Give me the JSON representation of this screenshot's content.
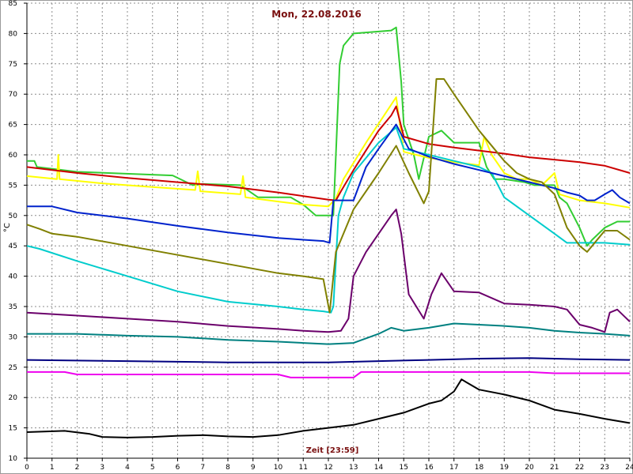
{
  "chart_data": {
    "type": "line",
    "title": "Mon, 22.08.2016",
    "xlabel": "Zeit [23:59]",
    "ylabel": "°C",
    "xlim": [
      0,
      24
    ],
    "ylim": [
      10,
      85
    ],
    "xticks": [
      0,
      1,
      2,
      3,
      4,
      5,
      6,
      7,
      8,
      9,
      10,
      11,
      12,
      13,
      14,
      15,
      16,
      17,
      18,
      19,
      20,
      21,
      22,
      23,
      24
    ],
    "yticks": [
      10,
      15,
      20,
      25,
      30,
      35,
      40,
      45,
      50,
      55,
      60,
      65,
      70,
      75,
      80,
      85
    ],
    "grid": true,
    "grid_style": "dashed",
    "legend": "none",
    "series": [
      {
        "color": "#32cd32",
        "points": [
          [
            0,
            59
          ],
          [
            0.3,
            59
          ],
          [
            0.4,
            58
          ],
          [
            2,
            57.2
          ],
          [
            5.8,
            56.6
          ],
          [
            6.6,
            55
          ],
          [
            7,
            55.2
          ],
          [
            8.5,
            55
          ],
          [
            9.2,
            53
          ],
          [
            10.5,
            53
          ],
          [
            11,
            51.8
          ],
          [
            11.5,
            50
          ],
          [
            12.2,
            50
          ],
          [
            12.3,
            60
          ],
          [
            12.45,
            75
          ],
          [
            12.6,
            78
          ],
          [
            13,
            80
          ],
          [
            14.5,
            80.5
          ],
          [
            14.7,
            81
          ],
          [
            14.9,
            72
          ],
          [
            15,
            65
          ],
          [
            15.4,
            60
          ],
          [
            15.6,
            56
          ],
          [
            16,
            63
          ],
          [
            16.5,
            64
          ],
          [
            17,
            62
          ],
          [
            18,
            62
          ],
          [
            18.3,
            58
          ],
          [
            18.6,
            56
          ],
          [
            19,
            56
          ],
          [
            19.8,
            55.5
          ],
          [
            20.2,
            55
          ],
          [
            21,
            55
          ],
          [
            21.2,
            53
          ],
          [
            21.5,
            52
          ],
          [
            22,
            48
          ],
          [
            22.3,
            45
          ],
          [
            22.5,
            46
          ],
          [
            23,
            48
          ],
          [
            23.5,
            49
          ],
          [
            24,
            49
          ]
        ]
      },
      {
        "color": "#ffff00",
        "points": [
          [
            0,
            56.5
          ],
          [
            1.2,
            56
          ],
          [
            1.25,
            60
          ],
          [
            1.3,
            56
          ],
          [
            3,
            55.3
          ],
          [
            5,
            54.7
          ],
          [
            6.7,
            54.2
          ],
          [
            6.8,
            57.3
          ],
          [
            6.9,
            54
          ],
          [
            8.5,
            53.5
          ],
          [
            8.6,
            56.5
          ],
          [
            8.7,
            53
          ],
          [
            10,
            52.3
          ],
          [
            11,
            51.8
          ],
          [
            12,
            51.5
          ],
          [
            12.3,
            52.8
          ],
          [
            12.6,
            56
          ],
          [
            13.5,
            62
          ],
          [
            14.3,
            67
          ],
          [
            14.7,
            69.5
          ],
          [
            15,
            60.5
          ],
          [
            15.5,
            60
          ],
          [
            16,
            59.5
          ],
          [
            17,
            58.8
          ],
          [
            18,
            58.3
          ],
          [
            18.2,
            63
          ],
          [
            18.5,
            60
          ],
          [
            19,
            57
          ],
          [
            19.5,
            56
          ],
          [
            20,
            56
          ],
          [
            20.5,
            55
          ],
          [
            21,
            57
          ],
          [
            21.2,
            53.5
          ],
          [
            22,
            52.5
          ],
          [
            23,
            52
          ],
          [
            24,
            51.3
          ]
        ]
      },
      {
        "color": "#cc0000",
        "points": [
          [
            0,
            58
          ],
          [
            2,
            57
          ],
          [
            4,
            56.2
          ],
          [
            6,
            55.5
          ],
          [
            8,
            54.8
          ],
          [
            10,
            53.8
          ],
          [
            11,
            53.2
          ],
          [
            12,
            52.6
          ],
          [
            12.3,
            52.5
          ],
          [
            12.5,
            54
          ],
          [
            13,
            57.5
          ],
          [
            14,
            64
          ],
          [
            14.5,
            66.5
          ],
          [
            14.7,
            68
          ],
          [
            15,
            63
          ],
          [
            16,
            61.8
          ],
          [
            17,
            61.2
          ],
          [
            18,
            60.7
          ],
          [
            19,
            60.2
          ],
          [
            20,
            59.6
          ],
          [
            21,
            59.2
          ],
          [
            22,
            58.8
          ],
          [
            23,
            58.2
          ],
          [
            24,
            57
          ]
        ]
      },
      {
        "color": "#00cccc",
        "points": [
          [
            0,
            45
          ],
          [
            0.5,
            44.5
          ],
          [
            2,
            42.5
          ],
          [
            4,
            40
          ],
          [
            6,
            37.5
          ],
          [
            8,
            35.8
          ],
          [
            10,
            35
          ],
          [
            11,
            34.5
          ],
          [
            11.8,
            34.2
          ],
          [
            12.1,
            34
          ],
          [
            12.2,
            35
          ],
          [
            12.4,
            50
          ],
          [
            12.6,
            53
          ],
          [
            13,
            57
          ],
          [
            14,
            62
          ],
          [
            14.7,
            64.5
          ],
          [
            15,
            61
          ],
          [
            16,
            60
          ],
          [
            16.5,
            59.5
          ],
          [
            17,
            59
          ],
          [
            17.5,
            58.5
          ],
          [
            18,
            58
          ],
          [
            18.5,
            57
          ],
          [
            19,
            53
          ],
          [
            20,
            50
          ],
          [
            21,
            47
          ],
          [
            21.5,
            45.5
          ],
          [
            22,
            45.5
          ],
          [
            23,
            45.5
          ],
          [
            24,
            45.2
          ]
        ]
      },
      {
        "color": "#0022cc",
        "points": [
          [
            0,
            51.5
          ],
          [
            1,
            51.5
          ],
          [
            2,
            50.5
          ],
          [
            4,
            49.5
          ],
          [
            6,
            48.3
          ],
          [
            8,
            47.2
          ],
          [
            10,
            46.3
          ],
          [
            11,
            46
          ],
          [
            11.8,
            45.8
          ],
          [
            12.05,
            45.5
          ],
          [
            12.2,
            52.5
          ],
          [
            13,
            52.5
          ],
          [
            13.5,
            58
          ],
          [
            14,
            61
          ],
          [
            14.7,
            65
          ],
          [
            15.2,
            61
          ],
          [
            16,
            59.7
          ],
          [
            17,
            58.5
          ],
          [
            18,
            57.5
          ],
          [
            19,
            56.5
          ],
          [
            20,
            55.5
          ],
          [
            21,
            54.5
          ],
          [
            21.5,
            53.8
          ],
          [
            22,
            53.3
          ],
          [
            22.3,
            52.5
          ],
          [
            22.6,
            52.5
          ],
          [
            23,
            53.5
          ],
          [
            23.3,
            54.2
          ],
          [
            23.6,
            53
          ],
          [
            24,
            52
          ]
        ]
      },
      {
        "color": "#808000",
        "points": [
          [
            0,
            48.5
          ],
          [
            0.5,
            47.8
          ],
          [
            1,
            47
          ],
          [
            2,
            46.5
          ],
          [
            4,
            45
          ],
          [
            6,
            43.5
          ],
          [
            8,
            42
          ],
          [
            10,
            40.5
          ],
          [
            11,
            40
          ],
          [
            11.8,
            39.5
          ],
          [
            12.05,
            34
          ],
          [
            12.3,
            44
          ],
          [
            13,
            51
          ],
          [
            14,
            57
          ],
          [
            14.7,
            61.5
          ],
          [
            15.2,
            57
          ],
          [
            15.8,
            52
          ],
          [
            16,
            54
          ],
          [
            16.3,
            72.5
          ],
          [
            16.6,
            72.5
          ],
          [
            17,
            70
          ],
          [
            18,
            64
          ],
          [
            19,
            59
          ],
          [
            19.5,
            57
          ],
          [
            20,
            56
          ],
          [
            20.5,
            55.5
          ],
          [
            21,
            53.5
          ],
          [
            21.5,
            48
          ],
          [
            22,
            45
          ],
          [
            22.3,
            44
          ],
          [
            22.5,
            45
          ],
          [
            23,
            47.5
          ],
          [
            23.5,
            47.5
          ],
          [
            24,
            46
          ]
        ]
      },
      {
        "color": "#6b006b",
        "points": [
          [
            0,
            34
          ],
          [
            2,
            33.5
          ],
          [
            4,
            33
          ],
          [
            6,
            32.5
          ],
          [
            8,
            31.8
          ],
          [
            10,
            31.3
          ],
          [
            11,
            31
          ],
          [
            12,
            30.8
          ],
          [
            12.5,
            31
          ],
          [
            12.8,
            33
          ],
          [
            13,
            40
          ],
          [
            13.5,
            44
          ],
          [
            14.5,
            50
          ],
          [
            14.7,
            51
          ],
          [
            14.9,
            47
          ],
          [
            15.2,
            37
          ],
          [
            15.8,
            33
          ],
          [
            16.1,
            37
          ],
          [
            16.5,
            40.5
          ],
          [
            17,
            37.5
          ],
          [
            18,
            37.3
          ],
          [
            19,
            35.5
          ],
          [
            20,
            35.3
          ],
          [
            21,
            35
          ],
          [
            21.5,
            34.5
          ],
          [
            22,
            32
          ],
          [
            22.5,
            31.5
          ],
          [
            23,
            30.8
          ],
          [
            23.2,
            34
          ],
          [
            23.5,
            34.5
          ],
          [
            24,
            32.5
          ]
        ]
      },
      {
        "color": "#008080",
        "points": [
          [
            0,
            30.5
          ],
          [
            2,
            30.5
          ],
          [
            4,
            30.2
          ],
          [
            6,
            30
          ],
          [
            8,
            29.5
          ],
          [
            10,
            29.2
          ],
          [
            11,
            29
          ],
          [
            12,
            28.8
          ],
          [
            13,
            29
          ],
          [
            14,
            30.5
          ],
          [
            14.5,
            31.5
          ],
          [
            15,
            31
          ],
          [
            16,
            31.5
          ],
          [
            17,
            32.2
          ],
          [
            18,
            32
          ],
          [
            19,
            31.8
          ],
          [
            20,
            31.5
          ],
          [
            21,
            31
          ],
          [
            22,
            30.7
          ],
          [
            23,
            30.5
          ],
          [
            24,
            30.2
          ]
        ]
      },
      {
        "color": "#000080",
        "points": [
          [
            0,
            26.2
          ],
          [
            4,
            26
          ],
          [
            8,
            25.8
          ],
          [
            12,
            25.8
          ],
          [
            14,
            26
          ],
          [
            16,
            26.2
          ],
          [
            18,
            26.4
          ],
          [
            20,
            26.5
          ],
          [
            22,
            26.3
          ],
          [
            24,
            26.2
          ]
        ]
      },
      {
        "color": "#ee00ee",
        "points": [
          [
            0,
            24.2
          ],
          [
            1.5,
            24.2
          ],
          [
            2,
            23.8
          ],
          [
            10,
            23.8
          ],
          [
            10.5,
            23.3
          ],
          [
            13,
            23.3
          ],
          [
            13.3,
            24.2
          ],
          [
            20,
            24.2
          ],
          [
            21,
            24
          ],
          [
            22,
            24
          ],
          [
            24,
            24
          ]
        ]
      },
      {
        "color": "#000000",
        "points": [
          [
            0,
            14.3
          ],
          [
            1.5,
            14.5
          ],
          [
            2.5,
            14
          ],
          [
            3,
            13.5
          ],
          [
            4,
            13.4
          ],
          [
            5,
            13.5
          ],
          [
            6,
            13.7
          ],
          [
            7,
            13.8
          ],
          [
            8,
            13.6
          ],
          [
            9,
            13.5
          ],
          [
            10,
            13.8
          ],
          [
            11,
            14.5
          ],
          [
            12,
            15
          ],
          [
            13,
            15.5
          ],
          [
            14,
            16.5
          ],
          [
            15,
            17.5
          ],
          [
            16,
            19
          ],
          [
            16.5,
            19.5
          ],
          [
            17,
            21
          ],
          [
            17.3,
            23
          ],
          [
            17.5,
            22.5
          ],
          [
            18,
            21.3
          ],
          [
            19,
            20.5
          ],
          [
            20,
            19.5
          ],
          [
            21,
            18
          ],
          [
            22,
            17.3
          ],
          [
            23,
            16.5
          ],
          [
            24,
            15.8
          ]
        ]
      }
    ]
  }
}
